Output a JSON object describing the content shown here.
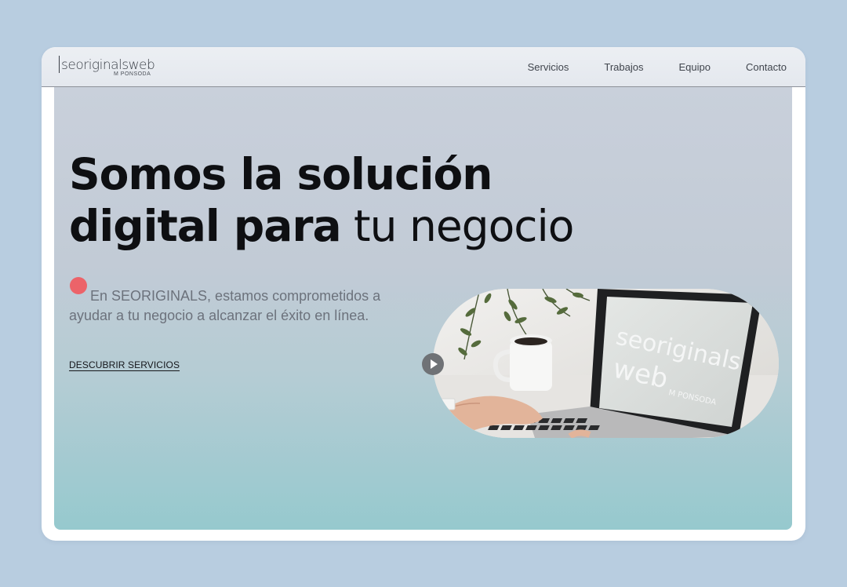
{
  "brand": {
    "logo_main": "seoriginalsweb",
    "logo_sub": "M PONSODA"
  },
  "nav": {
    "items": [
      {
        "label": "Servicios"
      },
      {
        "label": "Trabajos"
      },
      {
        "label": "Equipo"
      },
      {
        "label": "Contacto"
      }
    ]
  },
  "hero": {
    "headline_line1": "Somos la solución",
    "headline_line2_bold": "digital para",
    "headline_line2_light": " tu negocio",
    "intro": "En SEORIGINALS, estamos comprometidos a ayudar a tu negocio a alcanzar el éxito en línea.",
    "cta_label": "DESCUBRIR SERVICIOS"
  },
  "media": {
    "screen_logo_line1": "seoriginals",
    "screen_logo_line2": "web",
    "screen_logo_sub": "M PONSODA"
  },
  "colors": {
    "page_background": "#b8cde0",
    "accent_dot": "#ec6369",
    "headline": "#0e0f12",
    "body_text": "#6c727c",
    "play_button": "#6f7276"
  },
  "icons": {
    "play": "play-icon",
    "accent": "red-dot-icon"
  }
}
